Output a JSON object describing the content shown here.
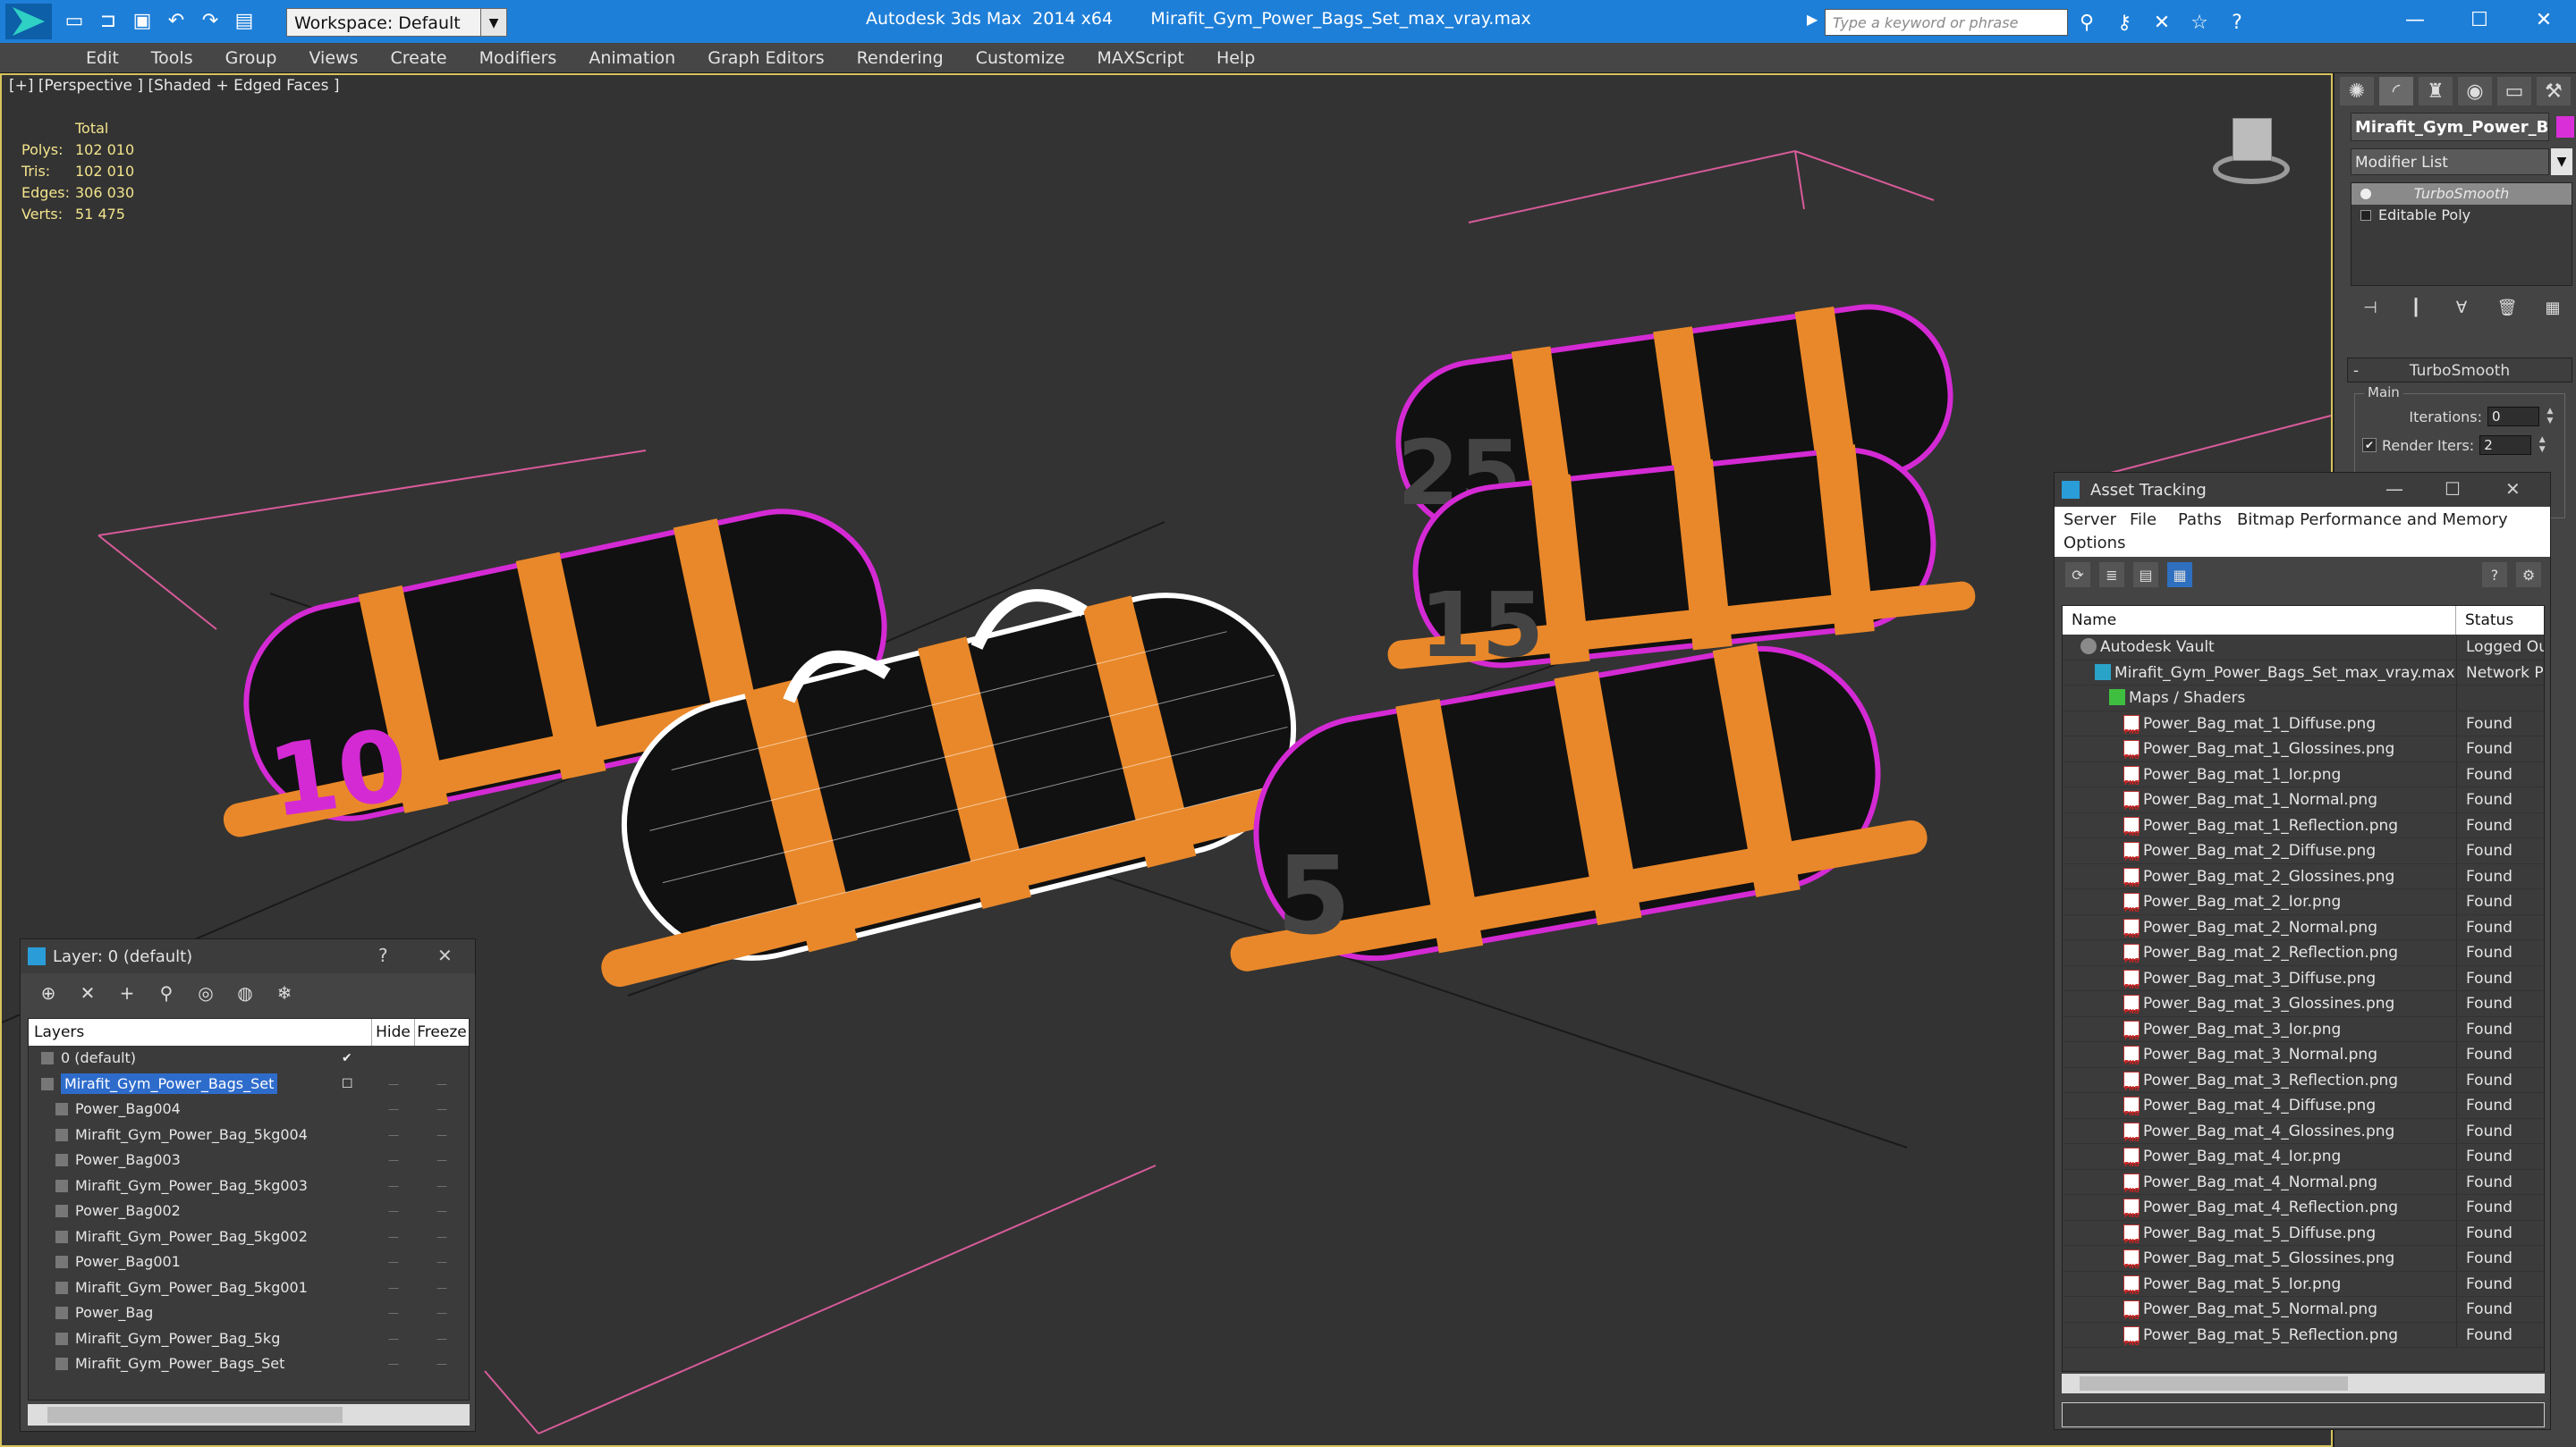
{
  "titlebar": {
    "workspace": "Workspace: Default",
    "app_title": "Autodesk 3ds Max  2014 x64",
    "file_title": "Mirafit_Gym_Power_Bags_Set_max_vray.max",
    "search_placeholder": "Type a keyword or phrase"
  },
  "menu": [
    "Edit",
    "Tools",
    "Group",
    "Views",
    "Create",
    "Modifiers",
    "Animation",
    "Graph Editors",
    "Rendering",
    "Customize",
    "MAXScript",
    "Help"
  ],
  "viewport": {
    "label": "[+] [Perspective ] [Shaded + Edged Faces ]",
    "stats": {
      "header": "Total",
      "rows": [
        {
          "k": "Polys:",
          "v": "102 010"
        },
        {
          "k": "Tris:",
          "v": "102 010"
        },
        {
          "k": "Edges:",
          "v": "306 030"
        },
        {
          "k": "Verts:",
          "v": "51 475"
        }
      ]
    },
    "bag_numbers": [
      "25",
      "15",
      "5",
      "10"
    ]
  },
  "command_panel": {
    "object_name": "Mirafit_Gym_Power_Bag",
    "object_color": "#d92fd9",
    "modifier_list": "Modifier List",
    "stack": [
      "TurboSmooth",
      "Editable Poly"
    ],
    "rollout": "TurboSmooth",
    "group": "Main",
    "iterations_label": "Iterations:",
    "iterations_value": "0",
    "render_iters_label": "Render Iters:",
    "render_iters_value": "2",
    "render_iters_checked": "✔"
  },
  "asset_tracking": {
    "title": "Asset Tracking",
    "menu": [
      "Server",
      "File",
      "Paths",
      "Bitmap Performance and Memory",
      "Options"
    ],
    "columns": {
      "name": "Name",
      "status": "Status"
    },
    "rows": [
      {
        "name": "Autodesk Vault",
        "status": "Logged Out",
        "indent": 1,
        "icon": "vault"
      },
      {
        "name": "Mirafit_Gym_Power_Bags_Set_max_vray.max",
        "status": "Network Path",
        "indent": 2,
        "icon": "max"
      },
      {
        "name": "Maps / Shaders",
        "status": "",
        "indent": 3,
        "icon": "maps"
      },
      {
        "name": "Power_Bag_mat_1_Diffuse.png",
        "status": "Found",
        "indent": 4,
        "icon": "png"
      },
      {
        "name": "Power_Bag_mat_1_Glossines.png",
        "status": "Found",
        "indent": 4,
        "icon": "png"
      },
      {
        "name": "Power_Bag_mat_1_Ior.png",
        "status": "Found",
        "indent": 4,
        "icon": "png"
      },
      {
        "name": "Power_Bag_mat_1_Normal.png",
        "status": "Found",
        "indent": 4,
        "icon": "png"
      },
      {
        "name": "Power_Bag_mat_1_Reflection.png",
        "status": "Found",
        "indent": 4,
        "icon": "png"
      },
      {
        "name": "Power_Bag_mat_2_Diffuse.png",
        "status": "Found",
        "indent": 4,
        "icon": "png"
      },
      {
        "name": "Power_Bag_mat_2_Glossines.png",
        "status": "Found",
        "indent": 4,
        "icon": "png"
      },
      {
        "name": "Power_Bag_mat_2_Ior.png",
        "status": "Found",
        "indent": 4,
        "icon": "png"
      },
      {
        "name": "Power_Bag_mat_2_Normal.png",
        "status": "Found",
        "indent": 4,
        "icon": "png"
      },
      {
        "name": "Power_Bag_mat_2_Reflection.png",
        "status": "Found",
        "indent": 4,
        "icon": "png"
      },
      {
        "name": "Power_Bag_mat_3_Diffuse.png",
        "status": "Found",
        "indent": 4,
        "icon": "png"
      },
      {
        "name": "Power_Bag_mat_3_Glossines.png",
        "status": "Found",
        "indent": 4,
        "icon": "png"
      },
      {
        "name": "Power_Bag_mat_3_Ior.png",
        "status": "Found",
        "indent": 4,
        "icon": "png"
      },
      {
        "name": "Power_Bag_mat_3_Normal.png",
        "status": "Found",
        "indent": 4,
        "icon": "png"
      },
      {
        "name": "Power_Bag_mat_3_Reflection.png",
        "status": "Found",
        "indent": 4,
        "icon": "png"
      },
      {
        "name": "Power_Bag_mat_4_Diffuse.png",
        "status": "Found",
        "indent": 4,
        "icon": "png"
      },
      {
        "name": "Power_Bag_mat_4_Glossines.png",
        "status": "Found",
        "indent": 4,
        "icon": "png"
      },
      {
        "name": "Power_Bag_mat_4_Ior.png",
        "status": "Found",
        "indent": 4,
        "icon": "png"
      },
      {
        "name": "Power_Bag_mat_4_Normal.png",
        "status": "Found",
        "indent": 4,
        "icon": "png"
      },
      {
        "name": "Power_Bag_mat_4_Reflection.png",
        "status": "Found",
        "indent": 4,
        "icon": "png"
      },
      {
        "name": "Power_Bag_mat_5_Diffuse.png",
        "status": "Found",
        "indent": 4,
        "icon": "png"
      },
      {
        "name": "Power_Bag_mat_5_Glossines.png",
        "status": "Found",
        "indent": 4,
        "icon": "png"
      },
      {
        "name": "Power_Bag_mat_5_Ior.png",
        "status": "Found",
        "indent": 4,
        "icon": "png"
      },
      {
        "name": "Power_Bag_mat_5_Normal.png",
        "status": "Found",
        "indent": 4,
        "icon": "png"
      },
      {
        "name": "Power_Bag_mat_5_Reflection.png",
        "status": "Found",
        "indent": 4,
        "icon": "png"
      }
    ]
  },
  "layers": {
    "title": "Layer: 0 (default)",
    "columns": {
      "layers": "Layers",
      "hide": "Hide",
      "freeze": "Freeze"
    },
    "rows": [
      {
        "name": "0 (default)",
        "indent": 1,
        "current": true,
        "selected": false
      },
      {
        "name": "Mirafit_Gym_Power_Bags_Set",
        "indent": 1,
        "current": false,
        "selected": true
      },
      {
        "name": "Power_Bag004",
        "indent": 2,
        "current": false,
        "selected": false
      },
      {
        "name": "Mirafit_Gym_Power_Bag_5kg004",
        "indent": 2,
        "current": false,
        "selected": false
      },
      {
        "name": "Power_Bag003",
        "indent": 2,
        "current": false,
        "selected": false
      },
      {
        "name": "Mirafit_Gym_Power_Bag_5kg003",
        "indent": 2,
        "current": false,
        "selected": false
      },
      {
        "name": "Power_Bag002",
        "indent": 2,
        "current": false,
        "selected": false
      },
      {
        "name": "Mirafit_Gym_Power_Bag_5kg002",
        "indent": 2,
        "current": false,
        "selected": false
      },
      {
        "name": "Power_Bag001",
        "indent": 2,
        "current": false,
        "selected": false
      },
      {
        "name": "Mirafit_Gym_Power_Bag_5kg001",
        "indent": 2,
        "current": false,
        "selected": false
      },
      {
        "name": "Power_Bag",
        "indent": 2,
        "current": false,
        "selected": false
      },
      {
        "name": "Mirafit_Gym_Power_Bag_5kg",
        "indent": 2,
        "current": false,
        "selected": false
      },
      {
        "name": "Mirafit_Gym_Power_Bags_Set",
        "indent": 2,
        "current": false,
        "selected": false
      }
    ]
  }
}
